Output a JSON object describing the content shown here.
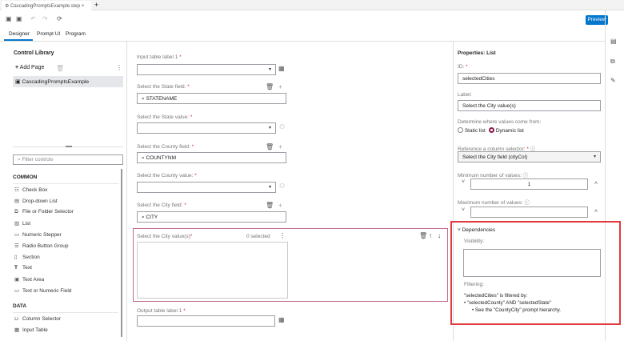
{
  "tab": {
    "title": "CascadingPromptsExample.step",
    "close": "×",
    "new": "+"
  },
  "toolbar": {
    "preview": "Preview"
  },
  "view_tabs": [
    "Designer",
    "Prompt UI",
    "Program"
  ],
  "library": {
    "title": "Control Library",
    "add_page": "Add Page",
    "page": "CascadingPromptsExample",
    "filter_placeholder": "Filter controls",
    "common_header": "COMMON",
    "common": [
      "Check Box",
      "Drop-down List",
      "File or Folder Selector",
      "List",
      "Numeric Stepper",
      "Radio Button Group",
      "Section",
      "Text",
      "Text Area",
      "Text or Numeric Field"
    ],
    "data_header": "DATA",
    "data": [
      "Column Selector",
      "Input Table"
    ]
  },
  "canvas": {
    "input_table_label": "Input table label 1",
    "state_field_label": "Select the State field:",
    "state_field_value": "STATENAME",
    "state_value_label": "Select the State value:",
    "county_field_label": "Select the County field:",
    "county_field_value": "COUNTYNM",
    "county_value_label": "Select the County value:",
    "city_field_label": "Select the City field:",
    "city_field_value": "CITY",
    "city_values_label": "Select the City value(s)",
    "selected_count": "0 selected",
    "output_table_label": "Output table label 1",
    "required": "*"
  },
  "properties": {
    "title": "Properties: List",
    "id_label": "ID:",
    "id_value": "selectedCities",
    "label_label": "Label:",
    "label_value": "Select the City value(s)",
    "source_label": "Determine where values come from:",
    "static": "Static list",
    "dynamic": "Dynamic list",
    "ref_label": "Reference a column selector:",
    "ref_value": "Select the City field (cityCol)",
    "min_label": "Minimum number of values:",
    "min_value": "1",
    "max_label": "Maximum number of values:",
    "max_value": "",
    "deps": "Dependencies",
    "visibility": "Visibility:",
    "filtering": "Filtering:",
    "filter_text": "\"selectedCities\" is filtered by:",
    "filter_bullet": "\"selectedCounty\" AND \"selectedState\"",
    "filter_sub": "See the \"CountyCity\" prompt hierarchy."
  },
  "colors": {
    "accent": "#0378cd",
    "highlight": "#e0393e",
    "selected_border": "#c06c90",
    "radio": "#8b1a4a"
  }
}
